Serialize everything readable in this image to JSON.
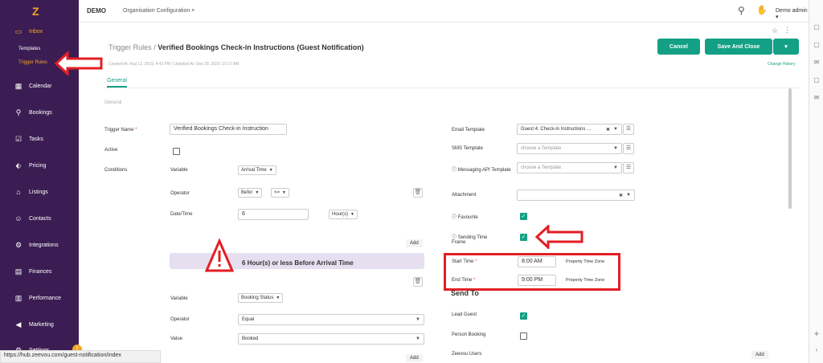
{
  "colors": {
    "sidebar": "#3b1d53",
    "accent": "#14a085",
    "highlight": "#f5a623",
    "annotation": "#e31e24"
  },
  "topbar": {
    "brand": "DEMO",
    "tab": "Organisation Configuration",
    "tab_close": "×",
    "user": "Demo admin",
    "user_caret": "▾"
  },
  "sidebar": {
    "items": [
      {
        "label": "Inbox",
        "icon": "inbox-icon"
      },
      {
        "label": "Calendar",
        "icon": "calendar-icon"
      },
      {
        "label": "Bookings",
        "icon": "bookings-icon"
      },
      {
        "label": "Tasks",
        "icon": "tasks-icon"
      },
      {
        "label": "Pricing",
        "icon": "pricing-icon"
      },
      {
        "label": "Listings",
        "icon": "listings-icon"
      },
      {
        "label": "Contacts",
        "icon": "contacts-icon"
      },
      {
        "label": "Integrations",
        "icon": "integrations-icon"
      },
      {
        "label": "Finances",
        "icon": "finances-icon"
      },
      {
        "label": "Performance",
        "icon": "performance-icon"
      },
      {
        "label": "Marketing",
        "icon": "marketing-icon"
      },
      {
        "label": "Settings",
        "icon": "settings-icon"
      }
    ],
    "subitems": [
      "Templates",
      "Trigger Rules"
    ]
  },
  "page": {
    "breadcrumb_parent": "Trigger Rules",
    "separator": "/",
    "title": "Verified Bookings Check-in Instructions (Guest Notification)",
    "meta": "Created At: Aug 12, 2019, 4:42 PM  |  Updated At: Sep 28, 2020, 10:17 AM",
    "cancel": "Cancel",
    "save_close": "Save And Close",
    "change_history": "Change History",
    "tab_general": "General",
    "section": "General"
  },
  "form": {
    "trigger_name_label": "Trigger Name",
    "required": "*",
    "trigger_name_value": "Verified Bookings Check-in Instruction",
    "active_label": "Active",
    "conditions_label": "Conditions",
    "variable_label": "Variable",
    "variable_value": "Arrival Time",
    "operator_label": "Operator",
    "operator_value1": "Befor",
    "operator_value2": "<=",
    "datetime_label": "Date/Time",
    "datetime_value": "6",
    "unit_value": "Hour(s)",
    "add": "Add",
    "banner": "6 Hour(s) or less Before Arrival Time",
    "variable2_value": "Booking Status",
    "operator2_value": "Equal",
    "value_label": "Value",
    "value2_value": "Booked"
  },
  "right_form": {
    "email_template_label": "Email Template",
    "email_template_value": "Guest 4: Check-in Instructions ...",
    "sms_template_label": "SMS Template",
    "sms_placeholder": "choose a Template",
    "messaging_label": "Messaging API Template",
    "messaging_placeholder": "choose a Template",
    "attachment_label": "Attachment",
    "favourite_label": "Favourite",
    "sending_label": "Sending Time Frame",
    "start_time_label": "Start Time",
    "start_time_value": "8:00 AM",
    "end_time_label": "End Time",
    "end_time_value": "9:00 PM",
    "timezone": "Property Time Zone",
    "send_to": "Send To",
    "lead_guest": "Lead Guest",
    "person_booking": "Person Booking",
    "zeevou_users": "Zeevou Users",
    "add": "Add"
  },
  "statusbar": "https://hub.zeevou.com/guest-notification/index"
}
